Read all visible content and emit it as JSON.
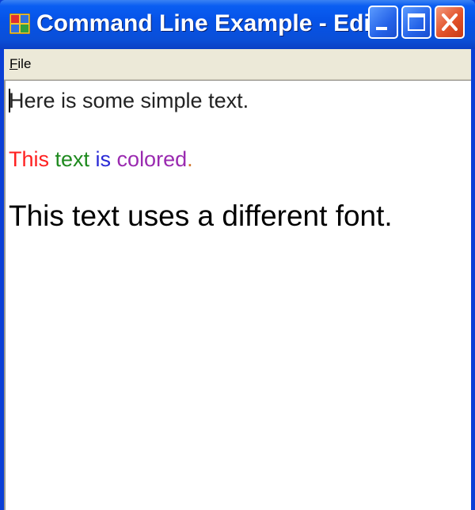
{
  "window": {
    "title": "Command Line Example - Edit...",
    "icon": "app-window-icon",
    "controls": [
      "minimize-icon",
      "maximize-icon",
      "close-icon"
    ]
  },
  "menu": {
    "items": [
      {
        "label_underlined": "F",
        "label_rest": "ile"
      }
    ]
  },
  "document": {
    "line1": "Here is some simple text.",
    "line2": [
      {
        "text": "This ",
        "color": "#ff2020"
      },
      {
        "text": "text ",
        "color": "#1f8a1f"
      },
      {
        "text": "is ",
        "color": "#2a2ad6"
      },
      {
        "text": "colored",
        "color": "#9a2ab0"
      },
      {
        "text": ".",
        "color": "#d07830"
      }
    ],
    "line3": "This text uses a different font."
  }
}
